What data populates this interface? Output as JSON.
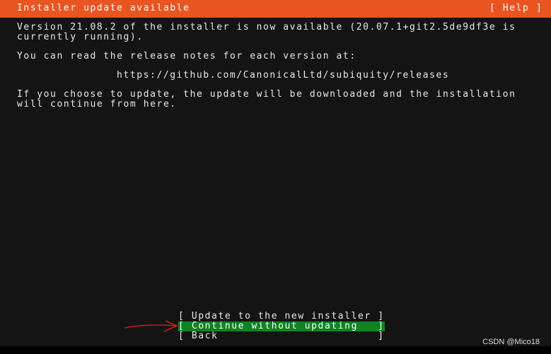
{
  "header": {
    "title": "Installer update available",
    "help_label": "[ Help ]",
    "color": "#e95420"
  },
  "body": {
    "lines": [
      "Version 21.08.2 of the installer is now available (20.07.1+git2.5de9df3e is",
      "currently running).",
      "You can read the release notes for each version at:",
      "https://github.com/CanonicalLtd/subiquity/releases",
      "If you choose to update, the update will be downloaded and the installation",
      "will continue from here."
    ]
  },
  "buttons": [
    {
      "label": "[ Update to the new installer ]",
      "selected": false
    },
    {
      "label": "[ Continue without updating   ]",
      "selected": true
    },
    {
      "label": "[ Back                        ]",
      "selected": false
    }
  ],
  "selected_color": "#0e8420",
  "watermark": "CSDN @Mico18"
}
